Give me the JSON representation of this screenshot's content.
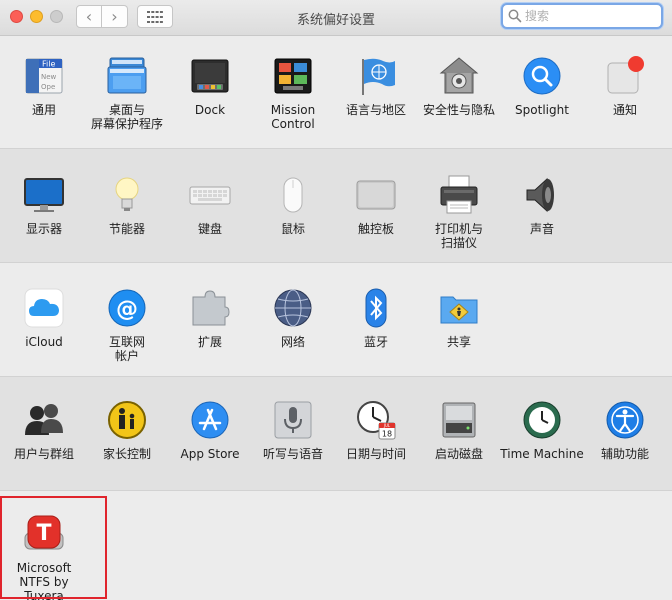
{
  "window": {
    "title": "系统偏好设置",
    "back_glyph": "‹",
    "forward_glyph": "›"
  },
  "search": {
    "placeholder": "搜索",
    "value": ""
  },
  "sections": [
    {
      "items": [
        {
          "label": "通用",
          "icon": "general-icon"
        },
        {
          "label": "桌面与\n屏幕保护程序",
          "icon": "desktop-screensaver-icon"
        },
        {
          "label": "Dock",
          "icon": "dock-icon"
        },
        {
          "label": "Mission\nControl",
          "icon": "mission-control-icon"
        },
        {
          "label": "语言与地区",
          "icon": "language-region-icon"
        },
        {
          "label": "安全性与隐私",
          "icon": "security-privacy-icon"
        },
        {
          "label": "Spotlight",
          "icon": "spotlight-icon"
        },
        {
          "label": "通知",
          "icon": "notifications-icon"
        }
      ]
    },
    {
      "items": [
        {
          "label": "显示器",
          "icon": "displays-icon"
        },
        {
          "label": "节能器",
          "icon": "energy-saver-icon"
        },
        {
          "label": "键盘",
          "icon": "keyboard-icon"
        },
        {
          "label": "鼠标",
          "icon": "mouse-icon"
        },
        {
          "label": "触控板",
          "icon": "trackpad-icon"
        },
        {
          "label": "打印机与\n扫描仪",
          "icon": "printer-scanner-icon"
        },
        {
          "label": "声音",
          "icon": "sound-icon"
        }
      ]
    },
    {
      "items": [
        {
          "label": "iCloud",
          "icon": "icloud-icon"
        },
        {
          "label": "互联网\n帐户",
          "icon": "internet-accounts-icon"
        },
        {
          "label": "扩展",
          "icon": "extensions-icon"
        },
        {
          "label": "网络",
          "icon": "network-icon"
        },
        {
          "label": "蓝牙",
          "icon": "bluetooth-icon"
        },
        {
          "label": "共享",
          "icon": "sharing-icon"
        }
      ]
    },
    {
      "items": [
        {
          "label": "用户与群组",
          "icon": "users-groups-icon"
        },
        {
          "label": "家长控制",
          "icon": "parental-controls-icon"
        },
        {
          "label": "App Store",
          "icon": "app-store-icon"
        },
        {
          "label": "听写与语音",
          "icon": "dictation-speech-icon"
        },
        {
          "label": "日期与时间",
          "icon": "date-time-icon"
        },
        {
          "label": "启动磁盘",
          "icon": "startup-disk-icon"
        },
        {
          "label": "Time Machine",
          "icon": "time-machine-icon"
        },
        {
          "label": "辅助功能",
          "icon": "accessibility-icon"
        }
      ]
    },
    {
      "items": [
        {
          "label": "Microsoft\nNTFS by Tuxera",
          "icon": "tuxera-ntfs-icon"
        }
      ]
    }
  ],
  "icon_text": {
    "general_file": "File",
    "general_new": "New",
    "general_ope": "Ope",
    "tuxera_letter": "T",
    "calendar_month": "JUL",
    "calendar_day": "18"
  },
  "colors": {
    "highlight_border": "#e0242c",
    "search_focus": "#7aa7e6",
    "accent_blue": "#1b8ef1"
  }
}
